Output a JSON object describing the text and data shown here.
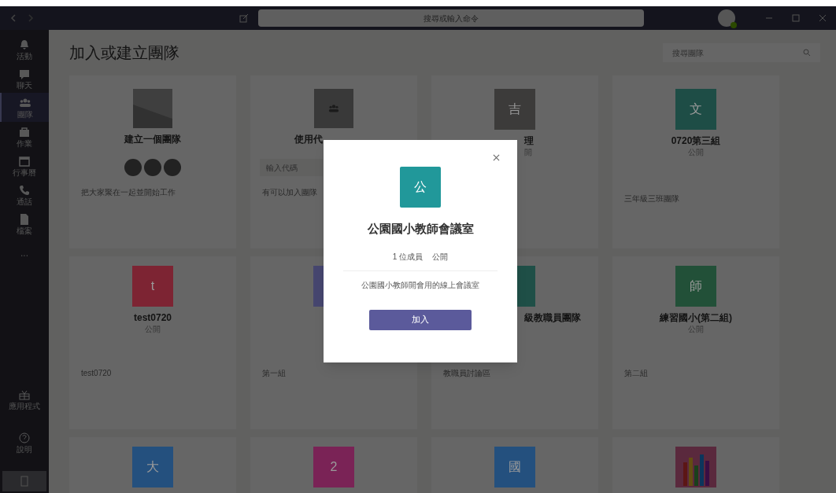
{
  "title_bar": {
    "search": {
      "placeholder": "搜尋或輸入命令"
    }
  },
  "sidebar": {
    "items": [
      {
        "label": "活動",
        "selected": false
      },
      {
        "label": "聊天",
        "selected": false
      },
      {
        "label": "團隊",
        "selected": true
      },
      {
        "label": "作業",
        "selected": false
      },
      {
        "label": "行事曆",
        "selected": false
      },
      {
        "label": "通話",
        "selected": false
      },
      {
        "label": "檔案",
        "selected": false
      }
    ],
    "more": "...",
    "bottom": [
      {
        "label": "應用程式"
      },
      {
        "label": "說明"
      }
    ]
  },
  "page": {
    "title": "加入或建立團隊",
    "search": {
      "placeholder": "搜尋團隊"
    }
  },
  "cards": [
    {
      "kind": "create",
      "title": "建立一個團隊",
      "description": "把大家聚在一起並開始工作"
    },
    {
      "kind": "code",
      "title": "使用代",
      "placeholder": "輸入代碼",
      "description": "有可以加入團隊"
    },
    {
      "kind": "team",
      "letter": "吉",
      "color": "#3c3b3a",
      "title": "理",
      "subtitle": "開"
    },
    {
      "kind": "team",
      "letter": "文",
      "color": "#1e4d46",
      "title": "0720第三組",
      "subtitle": "公開",
      "description": "三年級三班團隊"
    },
    {
      "kind": "team",
      "letter": "t",
      "color": "#7d2433",
      "title": "test0720",
      "subtitle": "公開",
      "description": "test0720"
    },
    {
      "kind": "team",
      "color": "#46466f",
      "description": "第一組"
    },
    {
      "kind": "team",
      "color": "#1f4f47",
      "title": "級教職員團隊",
      "description": "教職員討論區"
    },
    {
      "kind": "team",
      "letter": "師",
      "color": "#225038",
      "title": "練習國小(第二組)",
      "subtitle": "公開",
      "description": "第二組"
    },
    {
      "kind": "team",
      "letter": "大",
      "color": "#24507e"
    },
    {
      "kind": "team",
      "letter": "2",
      "color": "#7a2356"
    },
    {
      "kind": "team",
      "letter": "國",
      "color": "#24507e"
    },
    {
      "kind": "photo"
    }
  ],
  "dialog": {
    "letter": "公",
    "color": "#21989a",
    "title": "公園國小教師會議室",
    "members": "1 位成員",
    "privacy": "公開",
    "description": "公園國小教師開會用的線上會議室",
    "button": "加入"
  }
}
